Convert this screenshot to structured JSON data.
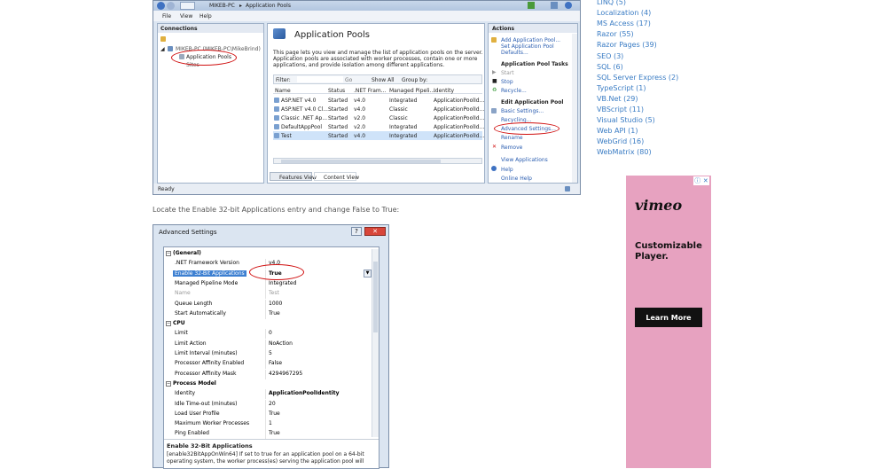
{
  "iis": {
    "breadcrumb": [
      "MIKEB-PC",
      "Application Pools"
    ],
    "menu": [
      "File",
      "View",
      "Help"
    ],
    "connections_header": "Connections",
    "tree": [
      "MIKEB-PC (MIKEB-PC\\MikeBrind)",
      "Application Pools",
      "Sites"
    ],
    "page_title": "Application Pools",
    "description": [
      "This page lets you view and manage the list of application pools on the server.",
      "Application pools are associated with worker processes, contain one or more",
      "applications, and provide isolation among different applications."
    ],
    "filter_label": "Filter:",
    "go_label": "Go",
    "show_all_label": "Show All",
    "group_by_label": "Group by:",
    "columns": [
      "Name",
      "Status",
      ".NET Fram...",
      "Managed Pipeli...",
      "Identity"
    ],
    "rows": [
      [
        "ASP.NET v4.0",
        "Started",
        "v4.0",
        "Integrated",
        "ApplicationPoolId..."
      ],
      [
        "ASP.NET v4.0 Cl...",
        "Started",
        "v4.0",
        "Classic",
        "ApplicationPoolId..."
      ],
      [
        "Classic .NET Ap...",
        "Started",
        "v2.0",
        "Classic",
        "ApplicationPoolId..."
      ],
      [
        "DefaultAppPool",
        "Started",
        "v2.0",
        "Integrated",
        "ApplicationPoolId..."
      ],
      [
        "Test",
        "Started",
        "v4.0",
        "Integrated",
        "ApplicationPoolId..."
      ]
    ],
    "view_tabs": [
      "Features View",
      "Content View"
    ],
    "actions_header": "Actions",
    "actions": {
      "add": "Add Application Pool...",
      "set_defaults": "Set Application Pool Defaults...",
      "tasks_head": "Application Pool Tasks",
      "start": "Start",
      "stop": "Stop",
      "recycle": "Recycle...",
      "edit_head": "Edit Application Pool",
      "basic": "Basic Settings...",
      "recycling": "Recycling...",
      "advanced": "Advanced Settings...",
      "rename": "Rename",
      "remove": "Remove",
      "view_apps": "View Applications",
      "help": "Help",
      "online_help": "Online Help"
    },
    "status": "Ready"
  },
  "article_text": "Locate the Enable 32-bit Applications entry and change False to True:",
  "advanced": {
    "title": "Advanced Settings",
    "rows": [
      {
        "type": "section",
        "key": "(General)"
      },
      {
        "key": ".NET Framework Version",
        "value": "v4.0"
      },
      {
        "key": "Enable 32-Bit Applications",
        "value": "True",
        "selected": true
      },
      {
        "key": "Managed Pipeline Mode",
        "value": "Integrated"
      },
      {
        "key": "Name",
        "value": "Test",
        "dim": true
      },
      {
        "key": "Queue Length",
        "value": "1000"
      },
      {
        "key": "Start Automatically",
        "value": "True"
      },
      {
        "type": "section",
        "key": "CPU"
      },
      {
        "key": "Limit",
        "value": "0"
      },
      {
        "key": "Limit Action",
        "value": "NoAction"
      },
      {
        "key": "Limit Interval (minutes)",
        "value": "5"
      },
      {
        "key": "Processor Affinity Enabled",
        "value": "False"
      },
      {
        "key": "Processor Affinity Mask",
        "value": "4294967295"
      },
      {
        "type": "section",
        "key": "Process Model"
      },
      {
        "key": "Identity",
        "value": "ApplicationPoolIdentity",
        "bold": true
      },
      {
        "key": "Idle Time-out (minutes)",
        "value": "20"
      },
      {
        "key": "Load User Profile",
        "value": "True"
      },
      {
        "key": "Maximum Worker Processes",
        "value": "1"
      },
      {
        "key": "Ping Enabled",
        "value": "True"
      }
    ],
    "desc_title": "Enable 32-Bit Applications",
    "desc_text1": "[enable32BitAppOnWin64] If set to true for an application pool on a 64-bit",
    "desc_text2": "operating system, the worker process(es) serving the application pool will"
  },
  "sidebar_links": [
    "LINQ (5)",
    "Localization (4)",
    "MS Access (17)",
    "Razor (55)",
    "Razor Pages (39)",
    "SEO (3)",
    "SQL (6)",
    "SQL Server Express (2)",
    "TypeScript (1)",
    "VB.Net (29)",
    "VBScript (11)",
    "Visual Studio (5)",
    "Web API (1)",
    "WebGrid (16)",
    "WebMatrix (80)"
  ],
  "ad": {
    "logo": "vimeo",
    "headline": "Customizable Player.",
    "cta": "Learn More"
  }
}
